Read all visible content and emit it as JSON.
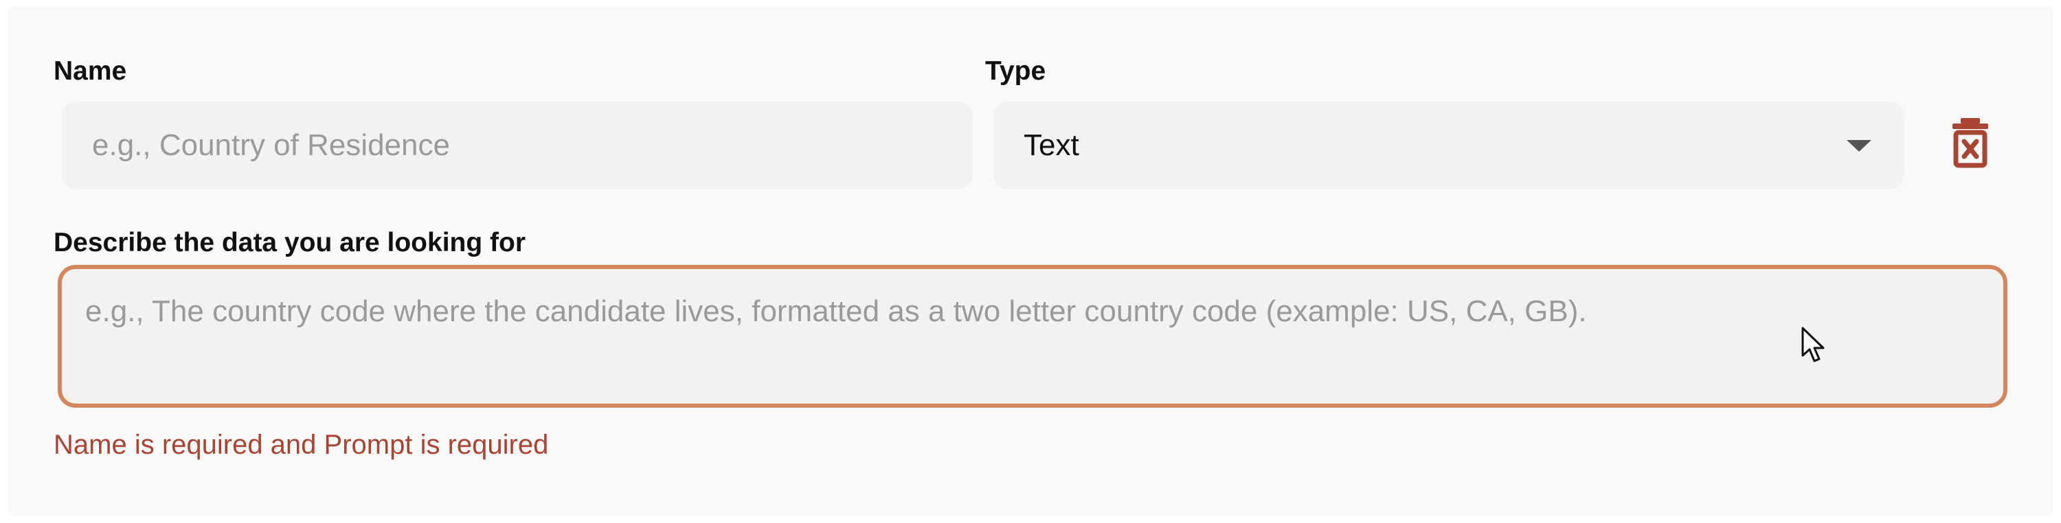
{
  "form": {
    "name": {
      "label": "Name",
      "value": "",
      "placeholder": "e.g., Country of Residence"
    },
    "type": {
      "label": "Type",
      "selected": "Text"
    },
    "prompt": {
      "label": "Describe the data you are looking for",
      "value": "",
      "placeholder": "e.g., The country code where the candidate lives, formatted as a two letter country code (example: US, CA, GB)."
    },
    "error_message": "Name is required and Prompt is required"
  },
  "icons": {
    "delete": "trash-x-icon",
    "dropdown": "caret-down-icon",
    "cursor": "mouse-pointer-icon"
  },
  "colors": {
    "error": "#a84432",
    "focus_border": "#d4865c",
    "delete_icon": "#a84432"
  }
}
